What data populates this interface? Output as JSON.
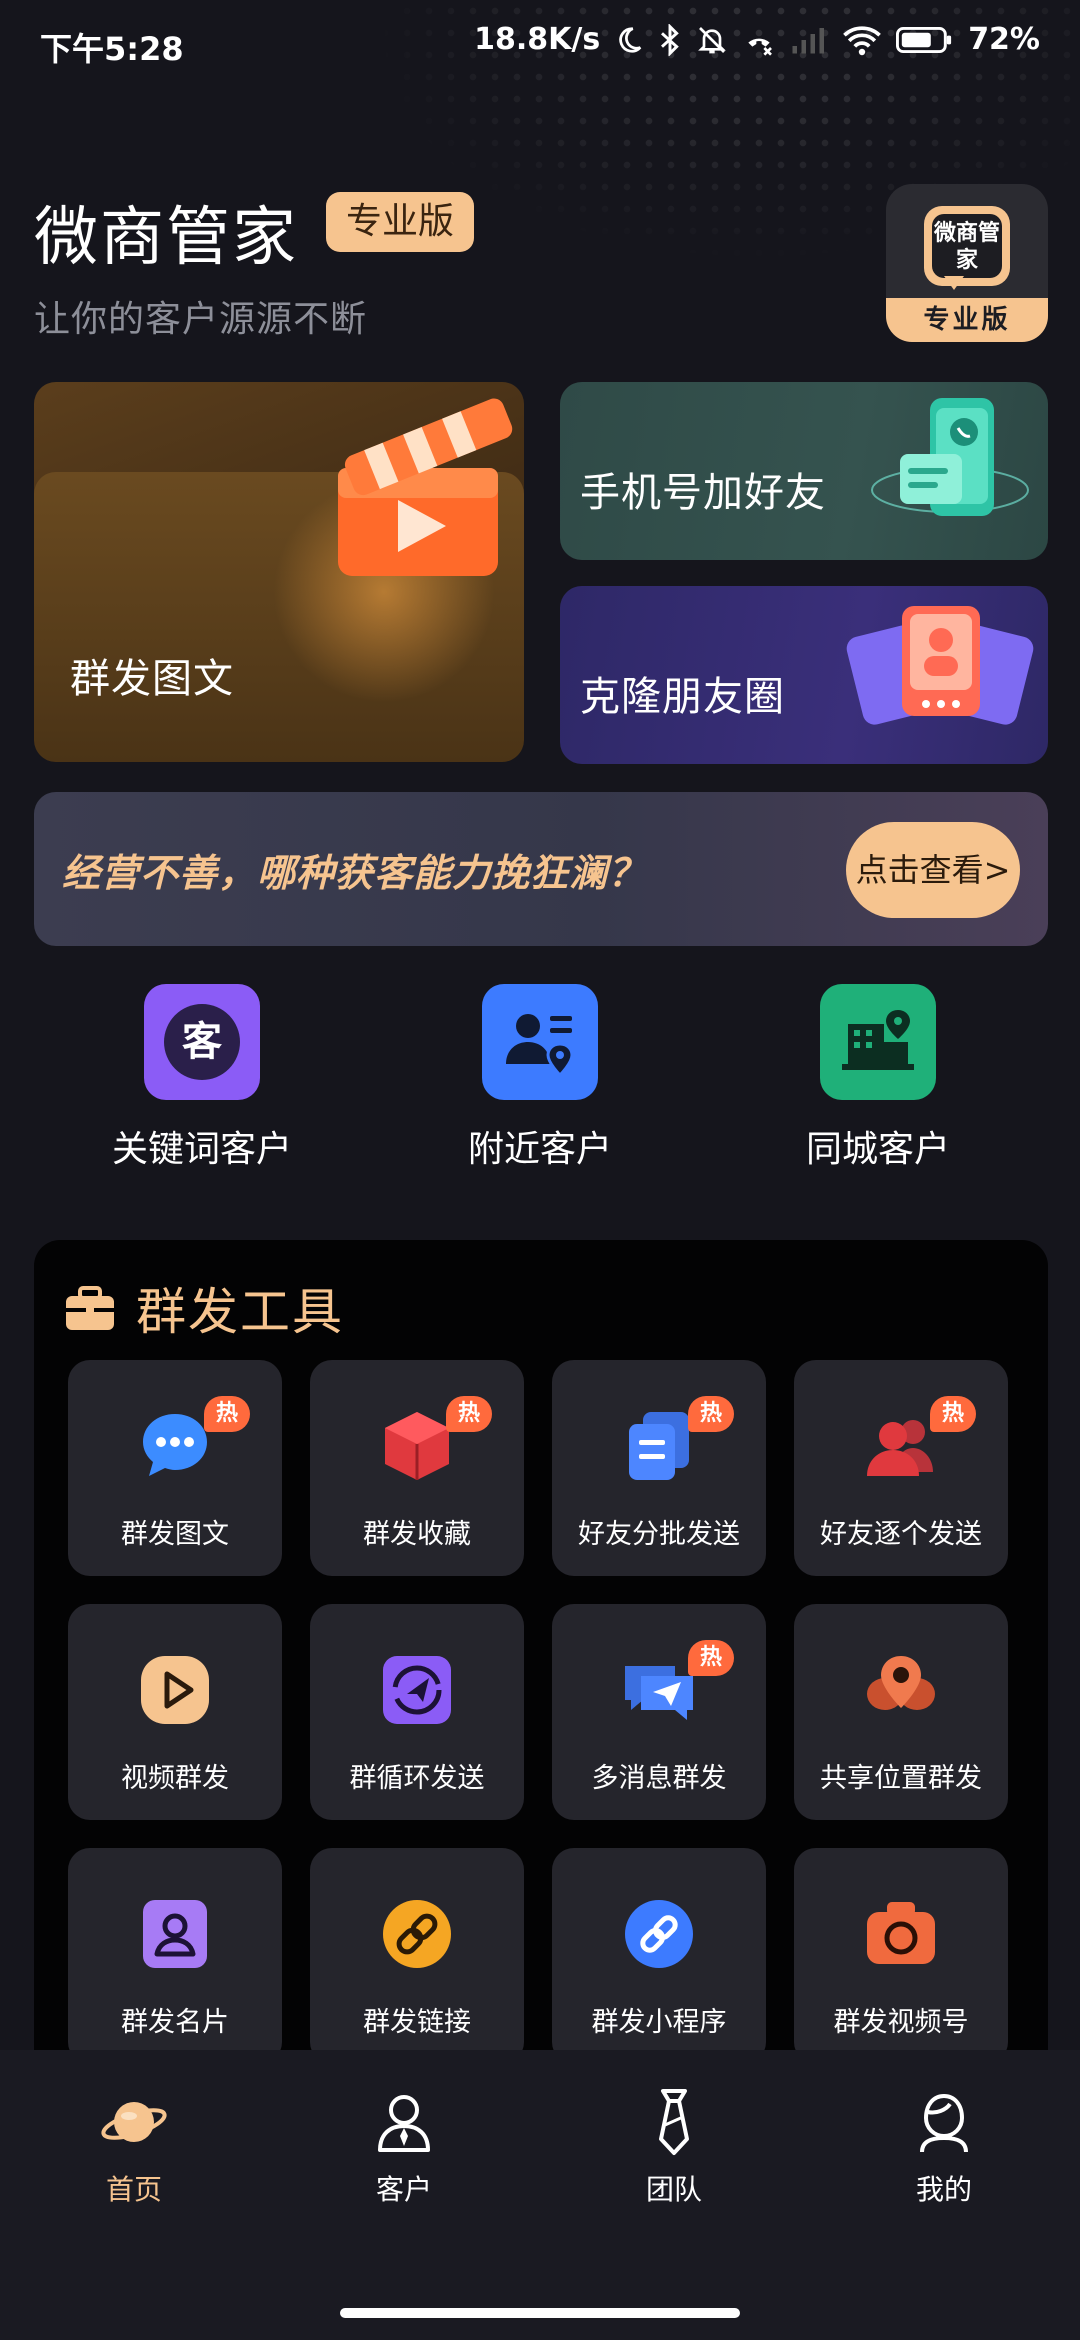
{
  "status_bar": {
    "time": "下午5:28",
    "net_speed": "18.8K/s",
    "battery": "72%"
  },
  "header": {
    "app_title": "微商管家",
    "edition_badge": "专业版",
    "subtitle": "让你的客户源源不断",
    "logo_text": "微商管家",
    "logo_band": "专业版"
  },
  "feature_cards": {
    "mass_post": "群发图文",
    "phone_add_friend": "手机号加好友",
    "clone_moments": "克隆朋友圈"
  },
  "banner": {
    "text": "经营不善，哪种获客能力挽狂澜？",
    "button": "点击查看>"
  },
  "quick_entries": [
    {
      "label": "关键词客户",
      "icon": "keyword-customer-icon",
      "color": "#8b5cf6"
    },
    {
      "label": "附近客户",
      "icon": "nearby-customer-icon",
      "color": "#3d7bff"
    },
    {
      "label": "同城客户",
      "icon": "same-city-customer-icon",
      "color": "#1fb079"
    }
  ],
  "tools": {
    "title": "群发工具",
    "hot_label": "热",
    "items": [
      {
        "label": "群发图文",
        "hot": true,
        "icon": "chat-bubble-icon"
      },
      {
        "label": "群发收藏",
        "hot": true,
        "icon": "cube-icon"
      },
      {
        "label": "好友分批发送",
        "hot": true,
        "icon": "batch-send-icon"
      },
      {
        "label": "好友逐个发送",
        "hot": true,
        "icon": "friends-icon"
      },
      {
        "label": "视频群发",
        "hot": false,
        "icon": "video-play-icon"
      },
      {
        "label": "群循环发送",
        "hot": false,
        "icon": "loop-send-icon"
      },
      {
        "label": "多消息群发",
        "hot": true,
        "icon": "multi-message-icon"
      },
      {
        "label": "共享位置群发",
        "hot": false,
        "icon": "location-share-icon"
      },
      {
        "label": "群发名片",
        "hot": false,
        "icon": "contact-card-icon"
      },
      {
        "label": "群发链接",
        "hot": false,
        "icon": "link-icon"
      },
      {
        "label": "群发小程序",
        "hot": false,
        "icon": "mini-program-icon"
      },
      {
        "label": "群发视频号",
        "hot": false,
        "icon": "camera-icon"
      }
    ]
  },
  "nav": [
    {
      "label": "首页",
      "active": true,
      "icon": "planet-icon"
    },
    {
      "label": "客户",
      "active": false,
      "icon": "customer-icon"
    },
    {
      "label": "团队",
      "active": false,
      "icon": "tie-icon"
    },
    {
      "label": "我的",
      "active": false,
      "icon": "profile-icon"
    }
  ],
  "colors": {
    "accent": "#f6c48f",
    "background": "#15151c",
    "panel": "#030304",
    "tile": "#25252c",
    "hot_badge": "#ff6a3d"
  }
}
